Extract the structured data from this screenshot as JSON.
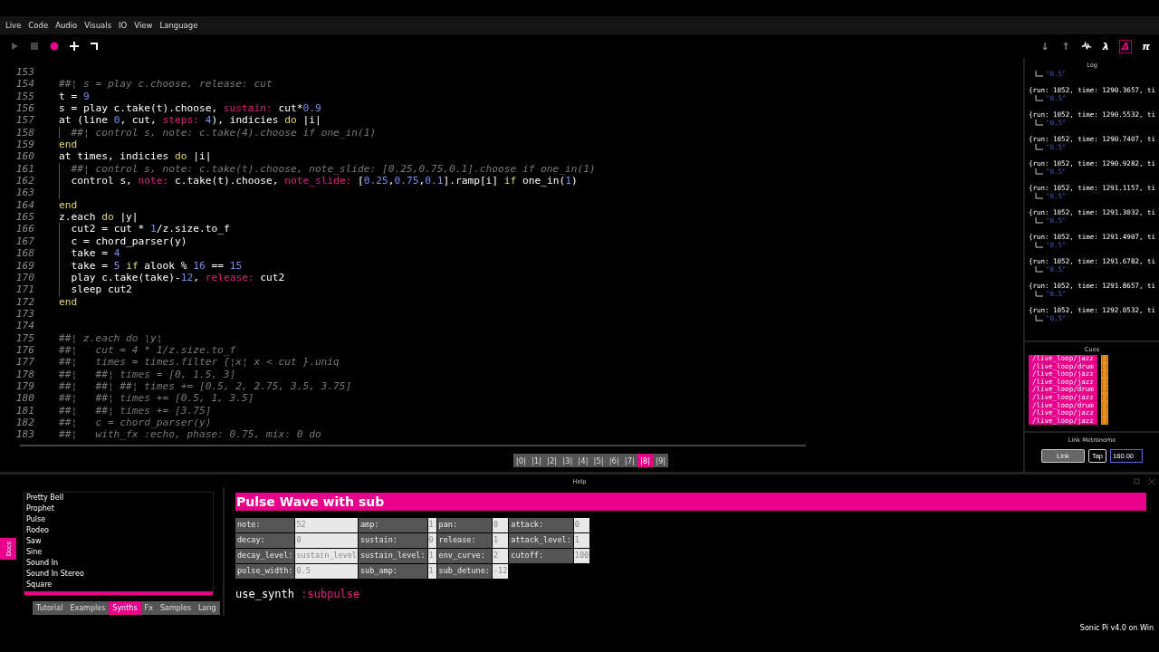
{
  "menu": [
    "Live",
    "Code",
    "Audio",
    "Visuals",
    "IO",
    "View",
    "Language"
  ],
  "toolbar": [
    {
      "kind": "play"
    },
    {
      "kind": "stop"
    },
    {
      "kind": "record"
    },
    {
      "kind": "plus"
    },
    {
      "kind": "wrap"
    }
  ],
  "view_tools": [
    {
      "kind": "glyph",
      "label": "↓",
      "selected": false
    },
    {
      "kind": "glyph",
      "label": "↑",
      "selected": false
    },
    {
      "kind": "scope",
      "selected": false
    },
    {
      "kind": "glyph",
      "label": "λ",
      "selected": false
    },
    {
      "kind": "glyph",
      "label": "Δ",
      "selected": true
    },
    {
      "kind": "glyph",
      "label": "π",
      "selected": false
    }
  ],
  "editor": {
    "lines": [
      {
        "number": "153",
        "guide": false
      },
      {
        "number": "154",
        "guide": false,
        "tokens": [
          {
            "kind": "comment",
            "text": "##¦ s = play c.choose, release: cut"
          }
        ]
      },
      {
        "number": "155",
        "guide": false,
        "tokens": [
          {
            "kind": "plain",
            "text": "t = "
          },
          {
            "kind": "num",
            "text": "9"
          }
        ]
      },
      {
        "number": "156",
        "guide": false,
        "tokens": [
          {
            "kind": "plain",
            "text": "s = play c.take(t).choose, "
          },
          {
            "kind": "sym",
            "text": "sustain:"
          },
          {
            "kind": "plain",
            "text": " cut*"
          },
          {
            "kind": "num",
            "text": "0.9"
          }
        ]
      },
      {
        "number": "157",
        "guide": false,
        "tokens": [
          {
            "kind": "plain",
            "text": "at (line "
          },
          {
            "kind": "num",
            "text": "0"
          },
          {
            "kind": "plain",
            "text": ", cut, "
          },
          {
            "kind": "sym",
            "text": "steps:"
          },
          {
            "kind": "num",
            "text": " 4"
          },
          {
            "kind": "plain",
            "text": "), indicies "
          },
          {
            "kind": "kw",
            "text": "do"
          },
          {
            "kind": "plain",
            "text": " |i|"
          }
        ]
      },
      {
        "number": "158",
        "guide": true,
        "tokens": [
          {
            "kind": "comment",
            "text": "##¦ control s, note: c.take(4).choose if one_in(1)"
          }
        ]
      },
      {
        "number": "159",
        "guide": false,
        "tokens": [
          {
            "kind": "kw",
            "text": "end"
          }
        ]
      },
      {
        "number": "160",
        "guide": false,
        "tokens": [
          {
            "kind": "plain",
            "text": "at times, indicies "
          },
          {
            "kind": "kw",
            "text": "do"
          },
          {
            "kind": "plain",
            "text": " |i|"
          }
        ]
      },
      {
        "number": "161",
        "guide": true,
        "tokens": [
          {
            "kind": "comment",
            "text": "##¦ control s, note: c.take(t).choose, note_slide: [0.25,0.75,0.1].choose if one_in(1)"
          }
        ]
      },
      {
        "number": "162",
        "guide": true,
        "tokens": [
          {
            "kind": "plain",
            "text": "control s, "
          },
          {
            "kind": "sym",
            "text": "note:"
          },
          {
            "kind": "plain",
            "text": " c.take(t).choose, "
          },
          {
            "kind": "sym",
            "text": "note_slide:"
          },
          {
            "kind": "plain",
            "text": " ["
          },
          {
            "kind": "num",
            "text": "0.25"
          },
          {
            "kind": "plain",
            "text": ","
          },
          {
            "kind": "num",
            "text": "0.75"
          },
          {
            "kind": "plain",
            "text": ","
          },
          {
            "kind": "num",
            "text": "0.1"
          },
          {
            "kind": "plain",
            "text": "].ramp[i] "
          },
          {
            "kind": "kw",
            "text": "if"
          },
          {
            "kind": "plain",
            "text": " one_in("
          },
          {
            "kind": "num",
            "text": "1"
          },
          {
            "kind": "plain",
            "text": ")"
          }
        ]
      },
      {
        "number": "163",
        "guide": true
      },
      {
        "number": "164",
        "guide": false,
        "tokens": [
          {
            "kind": "kw",
            "text": "end"
          }
        ]
      },
      {
        "number": "165",
        "guide": false,
        "tokens": [
          {
            "kind": "plain",
            "text": "z.each "
          },
          {
            "kind": "kw",
            "text": "do"
          },
          {
            "kind": "plain",
            "text": " |y|"
          }
        ]
      },
      {
        "number": "166",
        "guide": true,
        "tokens": [
          {
            "kind": "plain",
            "text": "cut2 = cut * "
          },
          {
            "kind": "num",
            "text": "1"
          },
          {
            "kind": "plain",
            "text": "/z.size.to_f"
          }
        ]
      },
      {
        "number": "167",
        "guide": true,
        "tokens": [
          {
            "kind": "plain",
            "text": "c = chord_parser(y)"
          }
        ]
      },
      {
        "number": "168",
        "guide": true,
        "tokens": [
          {
            "kind": "plain",
            "text": "take = "
          },
          {
            "kind": "num",
            "text": "4"
          }
        ]
      },
      {
        "number": "169",
        "guide": true,
        "tokens": [
          {
            "kind": "plain",
            "text": "take = "
          },
          {
            "kind": "num",
            "text": "5"
          },
          {
            "kind": "kw",
            "text": " if"
          },
          {
            "kind": "plain",
            "text": " alook % "
          },
          {
            "kind": "num",
            "text": "16"
          },
          {
            "kind": "plain",
            "text": " == "
          },
          {
            "kind": "num",
            "text": "15"
          }
        ]
      },
      {
        "number": "170",
        "guide": true,
        "tokens": [
          {
            "kind": "plain",
            "text": "play c.take(take)-"
          },
          {
            "kind": "num",
            "text": "12"
          },
          {
            "kind": "plain",
            "text": ", "
          },
          {
            "kind": "sym",
            "text": "release:"
          },
          {
            "kind": "plain",
            "text": " cut2"
          }
        ]
      },
      {
        "number": "171",
        "guide": true,
        "tokens": [
          {
            "kind": "plain",
            "text": "sleep cut2"
          }
        ]
      },
      {
        "number": "172",
        "guide": false,
        "tokens": [
          {
            "kind": "kw",
            "text": "end"
          }
        ]
      },
      {
        "number": "173",
        "guide": false
      },
      {
        "number": "174",
        "guide": false
      },
      {
        "number": "175",
        "guide": false,
        "tokens": [
          {
            "kind": "comment",
            "text": "##¦ z.each do ¦y¦"
          }
        ]
      },
      {
        "number": "176",
        "guide": false,
        "tokens": [
          {
            "kind": "comment",
            "text": "##¦   cut = 4 * 1/z.size.to_f"
          }
        ]
      },
      {
        "number": "177",
        "guide": false,
        "tokens": [
          {
            "kind": "comment",
            "text": "##¦   times = times.filter {¦x¦ x < cut }.uniq"
          }
        ]
      },
      {
        "number": "178",
        "guide": false,
        "tokens": [
          {
            "kind": "comment",
            "text": "##¦   ##¦ times = [0, 1.5, 3]"
          }
        ]
      },
      {
        "number": "179",
        "guide": false,
        "tokens": [
          {
            "kind": "comment",
            "text": "##¦   ##¦ ##¦ times += [0.5, 2, 2.75, 3.5, 3.75]"
          }
        ]
      },
      {
        "number": "180",
        "guide": false,
        "tokens": [
          {
            "kind": "comment",
            "text": "##¦   ##¦ times += [0.5, 1, 3.5]"
          }
        ]
      },
      {
        "number": "181",
        "guide": false,
        "tokens": [
          {
            "kind": "comment",
            "text": "##¦   ##¦ times += [3.75]"
          }
        ]
      },
      {
        "number": "182",
        "guide": false,
        "tokens": [
          {
            "kind": "comment",
            "text": "##¦   c = chord_parser(y)"
          }
        ]
      },
      {
        "number": "183",
        "guide": false,
        "tokens": [
          {
            "kind": "comment",
            "text": "##¦   with_fx :echo, phase: 0.75, mix: 0 do"
          }
        ]
      }
    ]
  },
  "buffers": [
    {
      "label": "|0|",
      "selected": false
    },
    {
      "label": "|1|",
      "selected": false
    },
    {
      "label": "|2|",
      "selected": false
    },
    {
      "label": "|3|",
      "selected": false
    },
    {
      "label": "|4|",
      "selected": false
    },
    {
      "label": "|5|",
      "selected": false
    },
    {
      "label": "|6|",
      "selected": false
    },
    {
      "label": "|7|",
      "selected": false
    },
    {
      "label": "|8|",
      "selected": true
    },
    {
      "label": "|9|",
      "selected": false
    }
  ],
  "log": {
    "title": "Log",
    "entries": [
      {
        "value": "\"0.5\""
      },
      {
        "text": "{run: 1052, time: 1290.3657, ti",
        "value": "\"0.5\""
      },
      {
        "text": "{run: 1052, time: 1290.5532, ti",
        "value": "\"0.5\""
      },
      {
        "text": "{run: 1052, time: 1290.7407, ti",
        "value": "\"0.5\""
      },
      {
        "text": "{run: 1052, time: 1290.9282, ti",
        "value": "\"0.5\""
      },
      {
        "text": "{run: 1052, time: 1291.1157, ti",
        "value": "\"0.5\""
      },
      {
        "text": "{run: 1052, time: 1291.3032, ti",
        "value": "\"0.5\""
      },
      {
        "text": "{run: 1052, time: 1291.4907, ti",
        "value": "\"0.5\""
      },
      {
        "text": "{run: 1052, time: 1291.6782, ti",
        "value": "\"0.5\""
      },
      {
        "text": "{run: 1052, time: 1291.8657, ti",
        "value": "\"0.5\""
      },
      {
        "text": "{run: 1052, time: 1292.0532, ti",
        "value": "\"0.5\""
      }
    ]
  },
  "cues": {
    "title": "Cues",
    "items": [
      {
        "path": "/live_loop/jazz",
        "value": "[]"
      },
      {
        "path": "/live_loop/drum",
        "value": "[]"
      },
      {
        "path": "/live_loop/jazz",
        "value": "[]"
      },
      {
        "path": "/live_loop/jazz",
        "value": "[]"
      },
      {
        "path": "/live_loop/drum",
        "value": "[]"
      },
      {
        "path": "/live_loop/jazz",
        "value": "[]"
      },
      {
        "path": "/live_loop/drum",
        "value": "[]"
      },
      {
        "path": "/live_loop/jazz",
        "value": "[]"
      },
      {
        "path": "/live_loop/jazz",
        "value": "[]"
      }
    ]
  },
  "metronome": {
    "title": "Link Metronome",
    "link_button": "Link",
    "tap_button": "Tap",
    "bpm": "160.00"
  },
  "help": {
    "title": "Help",
    "docs_tab": "Docs",
    "synths": [
      "Pretty Bell",
      "Prophet",
      "Pulse",
      "Rodeo",
      "Saw",
      "Sine",
      "Sound In",
      "Sound In Stereo",
      "Square"
    ],
    "doc_tabs": [
      {
        "label": "Tutorial",
        "selected": false
      },
      {
        "label": "Examples",
        "selected": false
      },
      {
        "label": "Synths",
        "selected": true
      },
      {
        "label": "Fx",
        "selected": false
      },
      {
        "label": "Samples",
        "selected": false
      },
      {
        "label": "Lang",
        "selected": false
      }
    ],
    "heading": "Pulse Wave with sub",
    "params": [
      [
        {
          "name": "note:",
          "value": "52"
        },
        {
          "name": "amp:",
          "value": "1"
        },
        {
          "name": "pan:",
          "value": "0"
        },
        {
          "name": "attack:",
          "value": "0"
        }
      ],
      [
        {
          "name": "decay:",
          "value": "0"
        },
        {
          "name": "sustain:",
          "value": "0"
        },
        {
          "name": "release:",
          "value": "1"
        },
        {
          "name": "attack_level:",
          "value": "1"
        }
      ],
      [
        {
          "name": "decay_level:",
          "value": "sustain_level"
        },
        {
          "name": "sustain_level:",
          "value": "1"
        },
        {
          "name": "env_curve:",
          "value": "2"
        },
        {
          "name": "cutoff:",
          "value": "100"
        }
      ],
      [
        {
          "name": "pulse_width:",
          "value": "0.5"
        },
        {
          "name": "sub_amp:",
          "value": "1"
        },
        {
          "name": "sub_detune:",
          "value": "-12"
        }
      ]
    ],
    "usage_fn": "use_synth",
    "usage_arg": ":subpulse"
  },
  "status": "Sonic Pi v4.0 on Win"
}
